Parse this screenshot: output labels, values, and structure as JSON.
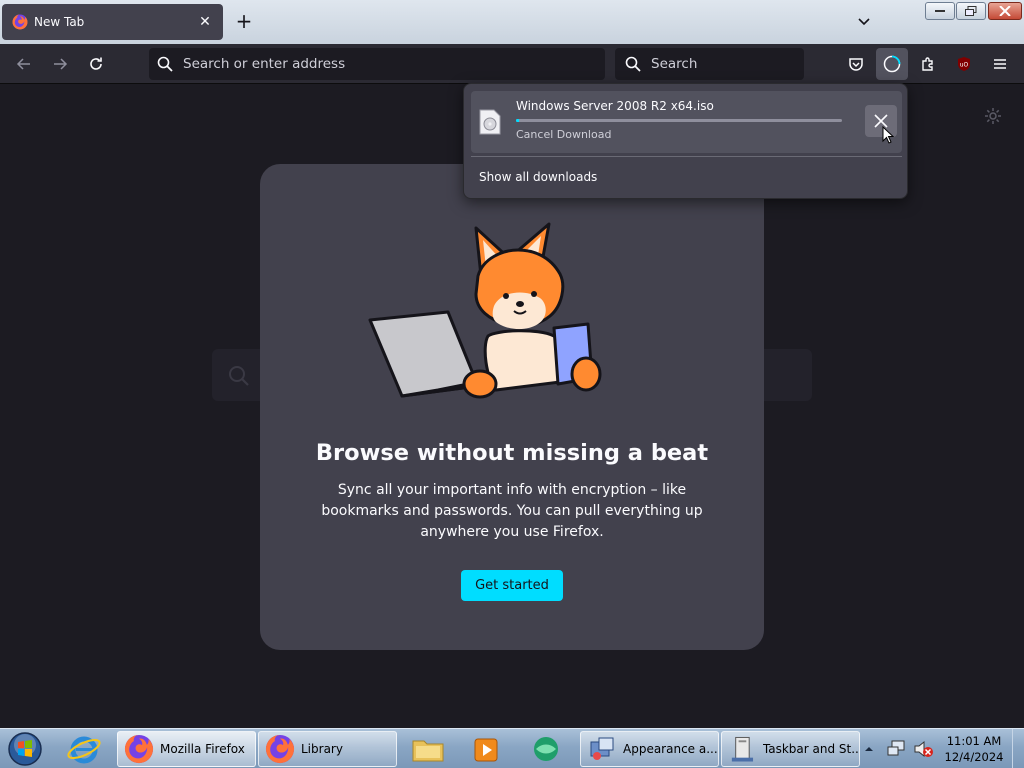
{
  "browser": {
    "tab_title": "New Tab",
    "url_placeholder": "Search or enter address",
    "search_placeholder": "Search"
  },
  "downloads": {
    "file_name": "Windows Server 2008 R2 x64.iso",
    "progress": 0.01,
    "status": "Cancel Download",
    "show_all": "Show all downloads"
  },
  "onboarding": {
    "heading": "Browse without missing a beat",
    "body": "Sync all your important info with encryption – like bookmarks and passwords. You can pull everything up anywhere you use Firefox.",
    "cta": "Get started"
  },
  "taskbar": {
    "items": [
      {
        "label": "Mozilla Firefox",
        "icon": "firefox-icon"
      },
      {
        "label": "Library",
        "icon": "firefox-icon"
      },
      {
        "label": "Appearance a...",
        "icon": "control-panel-icon"
      },
      {
        "label": "Taskbar and St...",
        "icon": "taskbar-properties-icon"
      }
    ],
    "time": "11:01 AM",
    "date": "12/4/2024"
  },
  "colors": {
    "accent": "#00ddff",
    "panel": "#42414d",
    "background": "#1c1b22"
  }
}
